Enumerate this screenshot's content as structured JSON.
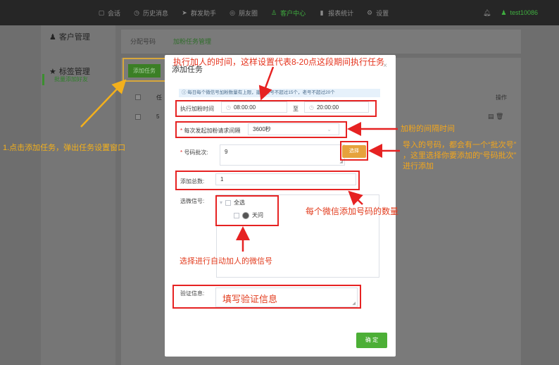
{
  "topbar": {
    "nav": [
      {
        "label": "会话",
        "icon": "chat-icon"
      },
      {
        "label": "历史消息",
        "icon": "clock-icon"
      },
      {
        "label": "群发助手",
        "icon": "send-icon"
      },
      {
        "label": "朋友圈",
        "icon": "aperture-icon"
      },
      {
        "label": "客户中心",
        "icon": "user-icon",
        "active": true
      },
      {
        "label": "报表统计",
        "icon": "bar-chart-icon"
      },
      {
        "label": "设置",
        "icon": "gear-icon"
      }
    ],
    "username": "test10086"
  },
  "sidebar": {
    "group1": "客户管理",
    "group1_sub": "批量添加好友",
    "group2": "标签管理"
  },
  "tabs": {
    "tab1": "分配号码",
    "tab2": "加粉任务管理"
  },
  "main": {
    "add_task_button": "添加任务",
    "operation_header": "操作",
    "row_col1": "任",
    "row_col2": "5"
  },
  "modal": {
    "title": "添加任务",
    "close": "×",
    "info_text": "ⓘ 每日每个微信号加粉数量有上限，建议新号不超过15个，老号不超过20个",
    "time_label": "执行加粉时间",
    "start_time": "08:00:00",
    "to_label": "至",
    "end_time": "20:00:00",
    "interval_label": "每次发起加粉请求间隔",
    "interval_value": "3600秒",
    "batch_label": "号码批次:",
    "batch_value": "9",
    "choose_button": "选择",
    "total_label": "添加总数:",
    "total_value": "1",
    "wechat_label": "选微信号:",
    "select_all": "全选",
    "wechat_account": "天问",
    "verify_label": "验证信息:",
    "confirm_button": "确 定"
  },
  "annotations": {
    "top": "执行加人的时间，这样设置代表8-20点这段期间执行任务",
    "left": "1.点击添加任务，弹出任务设置窗口",
    "interval": "加粉的间隔时间",
    "batch_line1": "导入的号码，都会有一个“批次号”",
    "batch_line2": "，这里选择你要添加的“号码批次”",
    "batch_line3": "进行添加",
    "total": "每个微信添加号码的数量",
    "wechat": "选择进行自动加人的微信号",
    "verify": "填写验证信息"
  },
  "colors": {
    "accent_green": "#4caf36",
    "annotation_red": "#e62222",
    "annotation_yellow": "#f3b01c"
  }
}
